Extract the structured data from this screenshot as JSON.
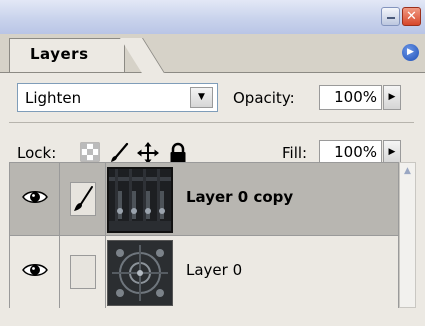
{
  "panel": {
    "tab_label": "Layers",
    "menu_icon": "flyout-menu-arrow-icon",
    "minimize_icon": "minimize-icon",
    "close_icon": "close-icon",
    "close_glyph": "✕"
  },
  "blend": {
    "value": "Lighten",
    "opacity_label": "Opacity:",
    "opacity_value": "100%"
  },
  "lock": {
    "label": "Lock:",
    "icons": [
      "lock-transparency-icon",
      "lock-paint-brush-icon",
      "lock-move-icon",
      "lock-all-padlock-icon"
    ],
    "fill_label": "Fill:",
    "fill_value": "100%"
  },
  "layers": [
    {
      "name": "Layer 0 copy",
      "selected": true,
      "visible": true,
      "linked_icon": "brush-icon"
    },
    {
      "name": "Layer 0",
      "selected": false,
      "visible": true,
      "linked_icon": ""
    }
  ],
  "colors": {
    "selected_row": "#b8b6b1",
    "panel_bg": "#ece9e3",
    "titlebar": "#c9d3ec",
    "close_button": "#d7472a",
    "menu_button": "#1e4fb7"
  }
}
